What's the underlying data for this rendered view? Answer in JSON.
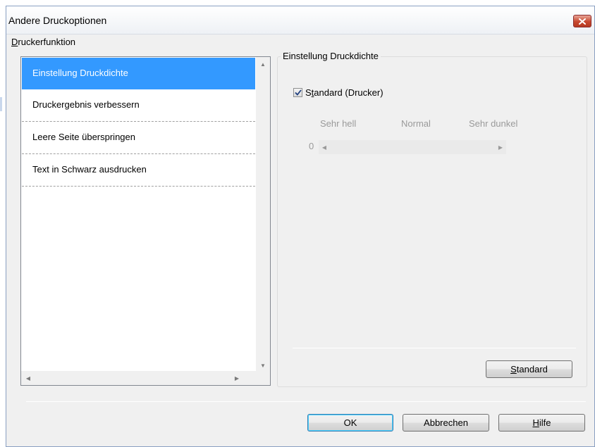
{
  "window": {
    "title": "Andere Druckoptionen",
    "close_icon": "close-icon"
  },
  "feature_group": {
    "label_underlined": "D",
    "label_rest": "ruckerfunktion"
  },
  "feature_list": {
    "items": [
      {
        "label": "Einstellung Druckdichte",
        "selected": true
      },
      {
        "label": "Druckergebnis verbessern",
        "selected": false
      },
      {
        "label": "Leere Seite überspringen",
        "selected": false
      },
      {
        "label": "Text in Schwarz ausdrucken",
        "selected": false
      }
    ]
  },
  "settings_group": {
    "title": "Einstellung Druckdichte",
    "standard_checkbox": {
      "label_prefix": "S",
      "label_underlined": "t",
      "label_rest": "andard (Drucker)",
      "checked": true
    },
    "density_labels": {
      "light": "Sehr hell",
      "normal": "Normal",
      "dark": "Sehr dunkel"
    },
    "density_value": "0",
    "standard_button": {
      "underlined": "S",
      "rest": "tandard"
    }
  },
  "buttons": {
    "ok": "OK",
    "cancel": "Abbrechen",
    "help_underlined": "H",
    "help_rest": "ilfe"
  },
  "colors": {
    "selection": "#3399ff",
    "close_button": "#c7482f",
    "dialog_bg": "#f0f0f0"
  }
}
